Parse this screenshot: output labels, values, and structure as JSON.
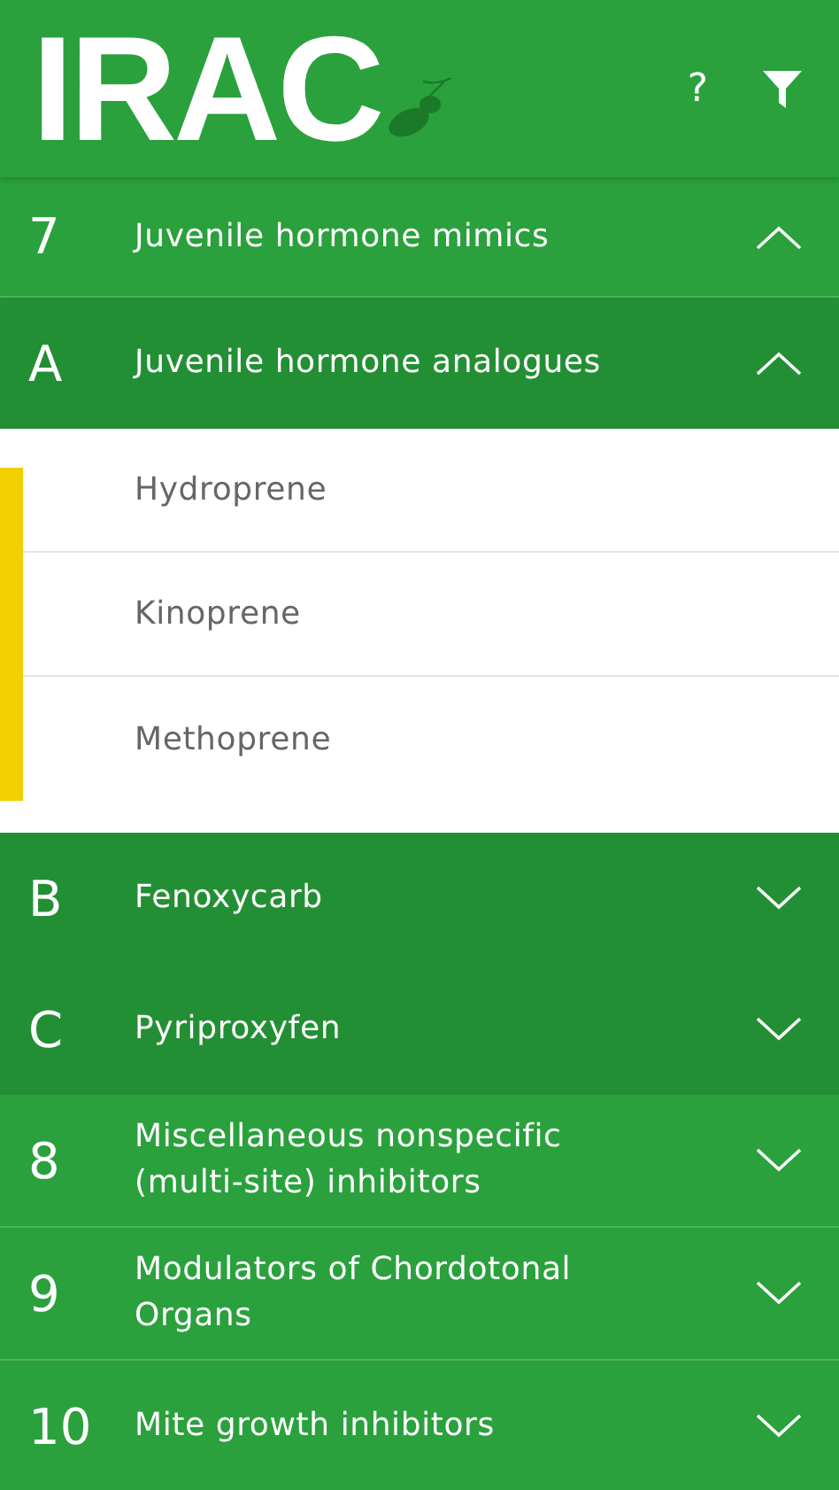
{
  "header": {
    "logo": "IRAC",
    "help": "?"
  },
  "groups": [
    {
      "code": "7",
      "name": "Juvenile hormone mimics",
      "expanded": true,
      "subgroups": [
        {
          "code": "A",
          "name": "Juvenile hormone analogues",
          "expanded": true,
          "compounds": [
            "Hydroprene",
            "Kinoprene",
            "Methoprene"
          ]
        },
        {
          "code": "B",
          "name": "Fenoxycarb",
          "expanded": false
        },
        {
          "code": "C",
          "name": "Pyriproxyfen",
          "expanded": false
        }
      ]
    },
    {
      "code": "8",
      "name": "Miscellaneous nonspecific (multi-site) inhibitors",
      "expanded": false
    },
    {
      "code": "9",
      "name": "Modulators of Chordotonal Organs",
      "expanded": false
    },
    {
      "code": "10",
      "name": "Mite growth inhibitors",
      "expanded": false
    }
  ]
}
